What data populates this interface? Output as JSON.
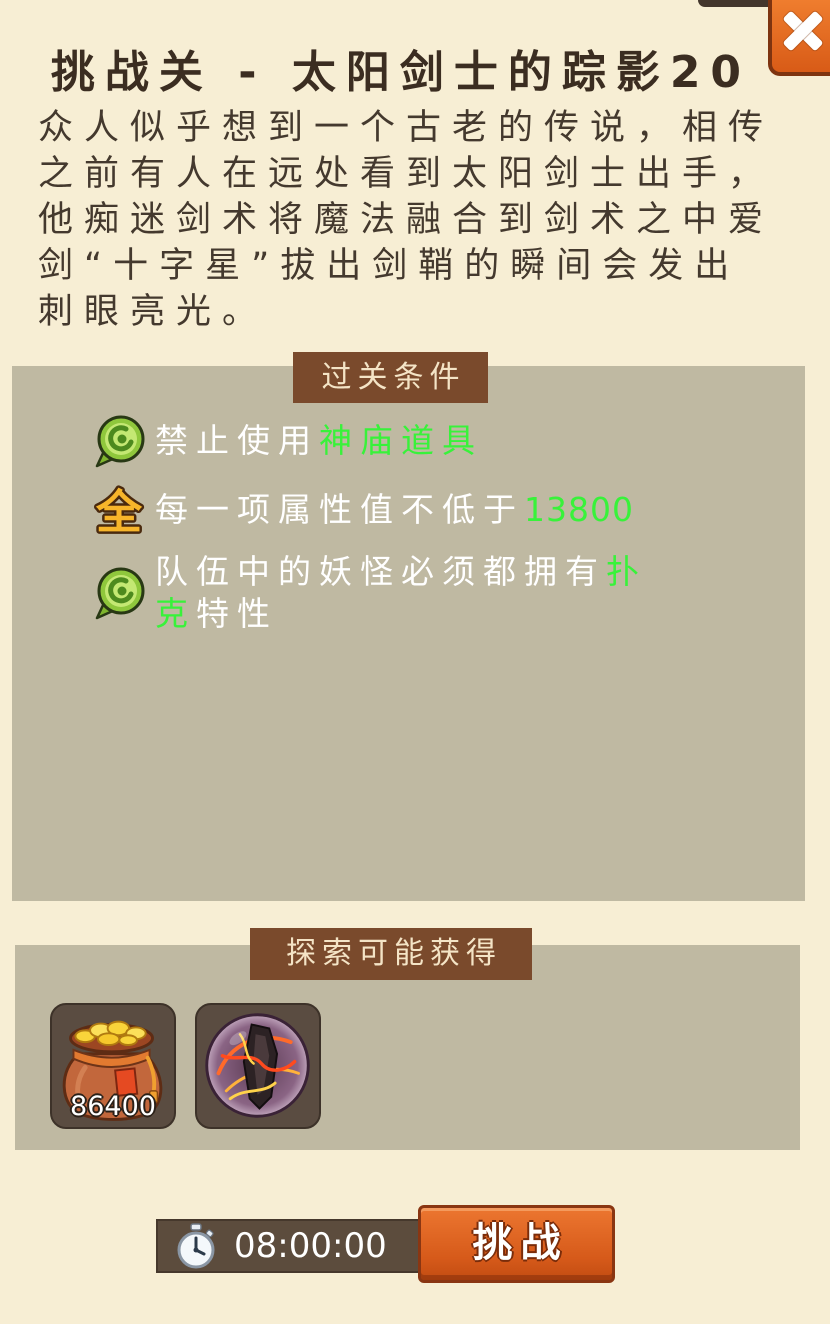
{
  "title": "挑战关 - 太阳剑士的踪影20",
  "description": {
    "lines": [
      "众人似乎想到一个古老的传说，相传",
      "之前有人在远处看到太阳剑士出手，",
      "他痴迷剑术将魔法融合到剑术之中爱",
      "剑“十字星”拔出剑鞘的瞬间会发出",
      "刺眼亮光。"
    ]
  },
  "conditions_panel": {
    "header": "过关条件",
    "conditions": [
      {
        "icon": "green-bubble-icon",
        "text": "禁止使用",
        "highlight": "神庙道具"
      },
      {
        "icon": "gold-quan-icon",
        "icon_text": "全",
        "text": "每一项属性值不低于",
        "highlight": "13800"
      },
      {
        "icon": "green-bubble-icon",
        "text": "队伍中的妖怪必须都拥有",
        "highlight": "扑克",
        "suffix": "特性"
      }
    ]
  },
  "rewards_panel": {
    "header": "探索可能获得",
    "items": [
      {
        "icon": "coin-bag-icon",
        "amount": "86400"
      },
      {
        "icon": "sword-orb-icon"
      }
    ]
  },
  "timer": {
    "icon": "stopwatch-icon",
    "value": "08:00:00"
  },
  "challenge_button": {
    "label": "挑战"
  },
  "close_button": {
    "icon": "close-icon"
  },
  "colors": {
    "background": "#f7eed4",
    "panel": "#bfb9a2",
    "tab": "#7a4a2c",
    "tab_text": "#f4e4c6",
    "highlight": "#38f23a",
    "title_text": "#3b2d21",
    "description_text": "#44392e",
    "button": "#d85b17"
  }
}
